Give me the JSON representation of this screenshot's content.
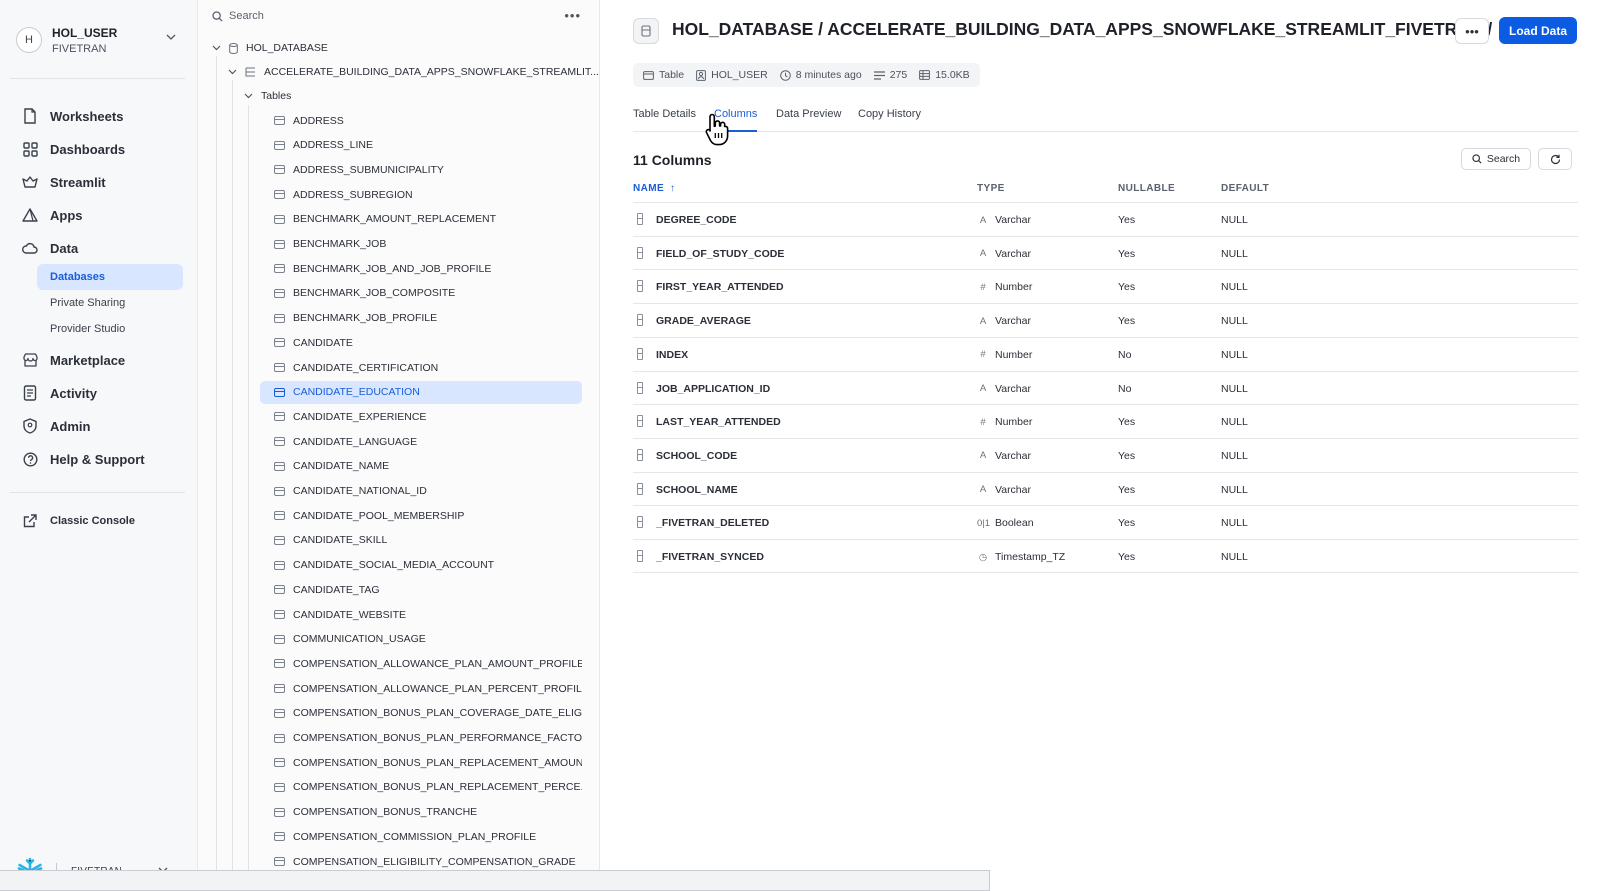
{
  "user": {
    "initial": "H",
    "name": "HOL_USER",
    "org": "FIVETRAN"
  },
  "nav": {
    "items": [
      {
        "label": "Worksheets",
        "icon": "worksheet-icon"
      },
      {
        "label": "Dashboards",
        "icon": "dashboard-icon"
      },
      {
        "label": "Streamlit",
        "icon": "streamlit-icon"
      },
      {
        "label": "Apps",
        "icon": "apps-icon"
      },
      {
        "label": "Data",
        "icon": "cloud-icon"
      }
    ],
    "data_sub": [
      {
        "label": "Databases",
        "active": true
      },
      {
        "label": "Private Sharing"
      },
      {
        "label": "Provider Studio"
      }
    ],
    "items2": [
      {
        "label": "Marketplace",
        "icon": "store-icon"
      },
      {
        "label": "Activity",
        "icon": "activity-icon"
      },
      {
        "label": "Admin",
        "icon": "shield-icon"
      },
      {
        "label": "Help & Support",
        "icon": "help-icon"
      }
    ],
    "classic_console": "Classic Console",
    "footer_org": "FIVETRAN"
  },
  "explorer": {
    "search_placeholder": "Search",
    "database": "HOL_DATABASE",
    "schema": "ACCELERATE_BUILDING_DATA_APPS_SNOWFLAKE_STREAMLIT...",
    "tables_label": "Tables",
    "tables": [
      "ADDRESS",
      "ADDRESS_LINE",
      "ADDRESS_SUBMUNICIPALITY",
      "ADDRESS_SUBREGION",
      "BENCHMARK_AMOUNT_REPLACEMENT",
      "BENCHMARK_JOB",
      "BENCHMARK_JOB_AND_JOB_PROFILE",
      "BENCHMARK_JOB_COMPOSITE",
      "BENCHMARK_JOB_PROFILE",
      "CANDIDATE",
      "CANDIDATE_CERTIFICATION",
      "CANDIDATE_EDUCATION",
      "CANDIDATE_EXPERIENCE",
      "CANDIDATE_LANGUAGE",
      "CANDIDATE_NAME",
      "CANDIDATE_NATIONAL_ID",
      "CANDIDATE_POOL_MEMBERSHIP",
      "CANDIDATE_SKILL",
      "CANDIDATE_SOCIAL_MEDIA_ACCOUNT",
      "CANDIDATE_TAG",
      "CANDIDATE_WEBSITE",
      "COMMUNICATION_USAGE",
      "COMPENSATION_ALLOWANCE_PLAN_AMOUNT_PROFILE",
      "COMPENSATION_ALLOWANCE_PLAN_PERCENT_PROFILE",
      "COMPENSATION_BONUS_PLAN_COVERAGE_DATE_ELIGI...",
      "COMPENSATION_BONUS_PLAN_PERFORMANCE_FACTO...",
      "COMPENSATION_BONUS_PLAN_REPLACEMENT_AMOUNT",
      "COMPENSATION_BONUS_PLAN_REPLACEMENT_PERCE...",
      "COMPENSATION_BONUS_TRANCHE",
      "COMPENSATION_COMMISSION_PLAN_PROFILE",
      "COMPENSATION_ELIGIBILITY_COMPENSATION_GRADE"
    ],
    "selected_table": "CANDIDATE_EDUCATION"
  },
  "main": {
    "breadcrumb": "HOL_DATABASE / ACCELERATE_BUILDING_DATA_APPS_SNOWFLAKE_STREAMLIT_FIVETRAN /",
    "load_button": "Load Data",
    "meta": {
      "kind": "Table",
      "owner": "HOL_USER",
      "updated": "8 minutes ago",
      "rows": "275",
      "size": "15.0KB"
    },
    "tabs": [
      {
        "label": "Table Details"
      },
      {
        "label": "Columns",
        "active": true
      },
      {
        "label": "Data Preview"
      },
      {
        "label": "Copy History"
      }
    ],
    "column_count": "11 Columns",
    "search_button": "Search",
    "headers": {
      "name": "NAME",
      "type": "TYPE",
      "nullable": "NULLABLE",
      "default": "DEFAULT"
    },
    "columns": [
      {
        "name": "DEGREE_CODE",
        "type": "Varchar",
        "type_icon": "text-type-icon",
        "nullable": "Yes",
        "default": "NULL"
      },
      {
        "name": "FIELD_OF_STUDY_CODE",
        "type": "Varchar",
        "type_icon": "text-type-icon",
        "nullable": "Yes",
        "default": "NULL"
      },
      {
        "name": "FIRST_YEAR_ATTENDED",
        "type": "Number",
        "type_icon": "number-type-icon",
        "nullable": "Yes",
        "default": "NULL"
      },
      {
        "name": "GRADE_AVERAGE",
        "type": "Varchar",
        "type_icon": "text-type-icon",
        "nullable": "Yes",
        "default": "NULL"
      },
      {
        "name": "INDEX",
        "type": "Number",
        "type_icon": "number-type-icon",
        "nullable": "No",
        "default": "NULL"
      },
      {
        "name": "JOB_APPLICATION_ID",
        "type": "Varchar",
        "type_icon": "text-type-icon",
        "nullable": "No",
        "default": "NULL"
      },
      {
        "name": "LAST_YEAR_ATTENDED",
        "type": "Number",
        "type_icon": "number-type-icon",
        "nullable": "Yes",
        "default": "NULL"
      },
      {
        "name": "SCHOOL_CODE",
        "type": "Varchar",
        "type_icon": "text-type-icon",
        "nullable": "Yes",
        "default": "NULL"
      },
      {
        "name": "SCHOOL_NAME",
        "type": "Varchar",
        "type_icon": "text-type-icon",
        "nullable": "Yes",
        "default": "NULL"
      },
      {
        "name": "_FIVETRAN_DELETED",
        "type": "Boolean",
        "type_icon": "boolean-type-icon",
        "nullable": "Yes",
        "default": "NULL"
      },
      {
        "name": "_FIVETRAN_SYNCED",
        "type": "Timestamp_TZ",
        "type_icon": "clock-type-icon",
        "nullable": "Yes",
        "default": "NULL"
      }
    ]
  },
  "colors": {
    "accent": "#0b5be3",
    "selected_bg": "#d8e7ff",
    "selected_text": "#1a5dd6"
  }
}
